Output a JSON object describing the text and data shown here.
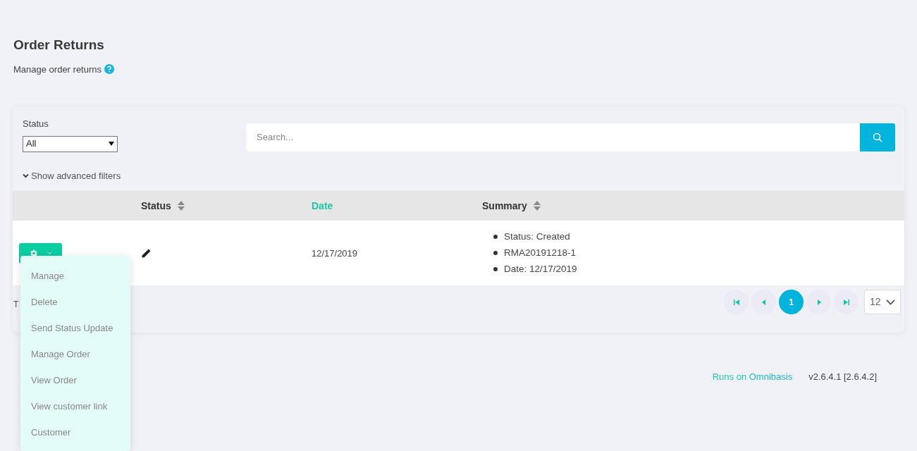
{
  "page": {
    "title": "Order Returns",
    "subtitle": "Manage order returns"
  },
  "filters": {
    "status_label": "Status",
    "status_value": "All",
    "search_placeholder": "Search...",
    "advanced_toggle": "Show advanced filters"
  },
  "table": {
    "columns": [
      {
        "label": "Status",
        "sorted": false
      },
      {
        "label": "Date",
        "sorted": true
      },
      {
        "label": "Summary",
        "sorted": false
      }
    ],
    "rows": [
      {
        "date": "12/17/2019",
        "summary": [
          "Status: Created",
          "RMA20191218-1",
          "Date: 12/17/2019"
        ]
      }
    ],
    "footer_text": "T"
  },
  "pagination": {
    "pages": [
      {
        "label": "1",
        "selected": true
      }
    ],
    "page_size": "12"
  },
  "action_menu": {
    "expanded": true,
    "items": [
      "Manage",
      "Delete",
      "Send Status Update",
      "Manage Order",
      "View Order",
      "View customer link",
      "Customer"
    ]
  },
  "footer": {
    "link": "Runs on Omnibasis",
    "version": "v2.6.4.1 [2.6.4.2]"
  }
}
